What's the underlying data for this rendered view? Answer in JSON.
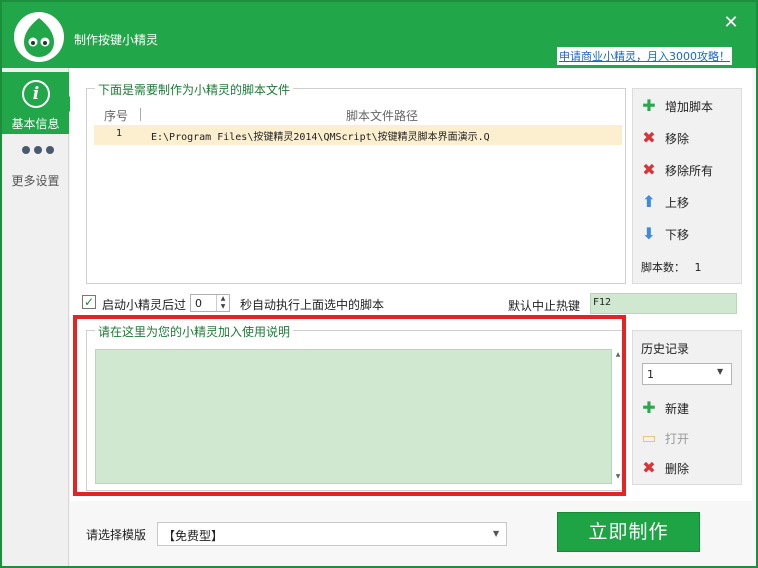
{
  "window": {
    "title": "制作按键小精灵",
    "promo_link": "申请商业小精灵，月入3000攻略！",
    "close_glyph": "✕"
  },
  "sidebar": {
    "items": [
      {
        "label": "基本信息",
        "icon": "info-icon",
        "glyph": "i",
        "active": true
      },
      {
        "label": "更多设置",
        "icon": "more-dots-icon",
        "active": false
      }
    ]
  },
  "script_group": {
    "legend": "下面是需要制作为小精灵的脚本文件",
    "columns": [
      "序号",
      "脚本文件路径"
    ],
    "rows": [
      {
        "no": "1",
        "path": "E:\\Program Files\\按键精灵2014\\QMScript\\按键精灵脚本界面演示.Q"
      }
    ]
  },
  "script_buttons": {
    "add": "增加脚本",
    "remove": "移除",
    "remove_all": "移除所有",
    "move_up": "上移",
    "move_down": "下移",
    "count_label": "脚本数：",
    "count_value": "1"
  },
  "autorun": {
    "checked": true,
    "check_glyph": "✓",
    "label_before": "启动小精灵后过",
    "seconds": "0",
    "label_after": "秒自动执行上面选中的脚本"
  },
  "hotkey": {
    "label": "默认中止热键",
    "value": "F12"
  },
  "description": {
    "legend": "请在这里为您的小精灵加入使用说明",
    "text": ""
  },
  "history": {
    "title": "历史记录",
    "selected": "1",
    "new": "新建",
    "open": "打开",
    "delete": "删除"
  },
  "footer": {
    "template_label": "请选择模版",
    "template_value": "【免费型】",
    "make_button": "立即制作"
  },
  "colors": {
    "brand_green": "#22a64a",
    "input_green": "#cfe8cf",
    "selected_row": "#fcefcf",
    "annotation_red": "#e22424",
    "link_blue": "#1a67c7"
  }
}
